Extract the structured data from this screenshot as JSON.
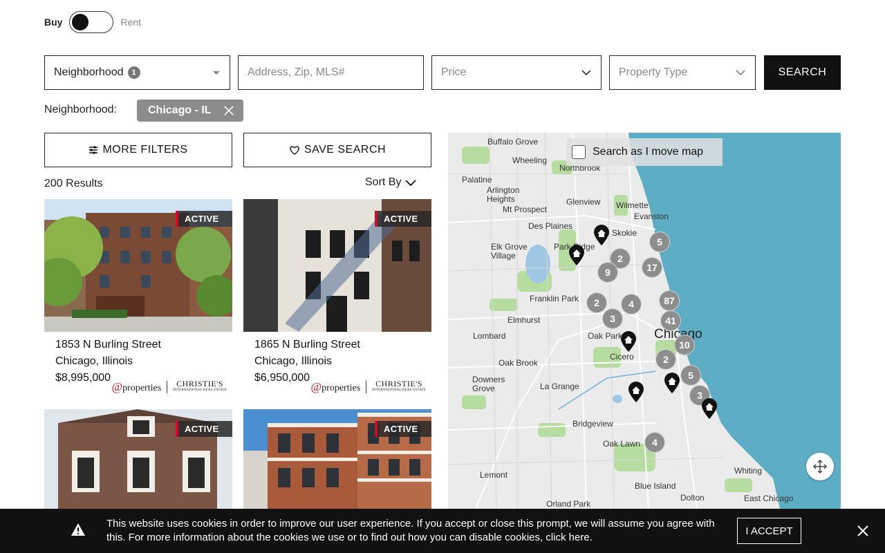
{
  "toggle": {
    "buy_label": "Buy",
    "rent_label": "Rent"
  },
  "search": {
    "neighborhood_label": "Neighborhood",
    "neighborhood_count": "1",
    "address_placeholder": "Address, Zip, MLS#",
    "price_label": "Price",
    "property_type_label": "Property Type",
    "search_button": "SEARCH"
  },
  "filters": {
    "neighborhood_tag_label": "Neighborhood:",
    "chip_value": "Chicago - IL",
    "more_filters": "MORE FILTERS",
    "save_search": "SAVE SEARCH"
  },
  "results": {
    "count_text": "200 Results",
    "sort_label": "Sort By"
  },
  "listings": [
    {
      "status": "ACTIVE",
      "street": "1853 N Burling Street",
      "city": "Chicago, Illinois",
      "price": "$8,995,000"
    },
    {
      "status": "ACTIVE",
      "street": "1865 N Burling Street",
      "city": "Chicago, Illinois",
      "price": "$6,950,000"
    },
    {
      "status": "ACTIVE"
    },
    {
      "status": "ACTIVE"
    }
  ],
  "brand": {
    "properties": "properties",
    "christies": "CHRISTIE'S",
    "christies_sub": "INTERNATIONAL REAL ESTATE"
  },
  "map": {
    "search_as_move": "Search as I move map",
    "labels": [
      "Buffalo Grove",
      "Wheeling",
      "Northbrook",
      "Palatine",
      "Arlington Heights",
      "Mt Prospect",
      "Glenview",
      "Wilmette",
      "Evanston",
      "Skokie",
      "Des Plaines",
      "Elk Grove Village",
      "Park Ridge",
      "Franklin Park",
      "Elmhurst",
      "Lombard",
      "Oak Park",
      "Cicero",
      "Oak Brook",
      "Downers Grove",
      "La Grange",
      "Bridgeview",
      "Oak Lawn",
      "Lemont",
      "Blue Island",
      "Dolton",
      "Whiting",
      "East Chicago",
      "Orland Park",
      "Chicago"
    ],
    "clusters": [
      "5",
      "2",
      "9",
      "17",
      "2",
      "4",
      "87",
      "3",
      "41",
      "10",
      "2",
      "5",
      "3",
      "4"
    ]
  },
  "cookie": {
    "message": "This website uses cookies in order to improve our user experience. If you accept or close this prompt, we will assume you agree with this. For more information about the cookies we use or to find out how you can disable cookies, click here.",
    "accept": "I ACCEPT"
  }
}
